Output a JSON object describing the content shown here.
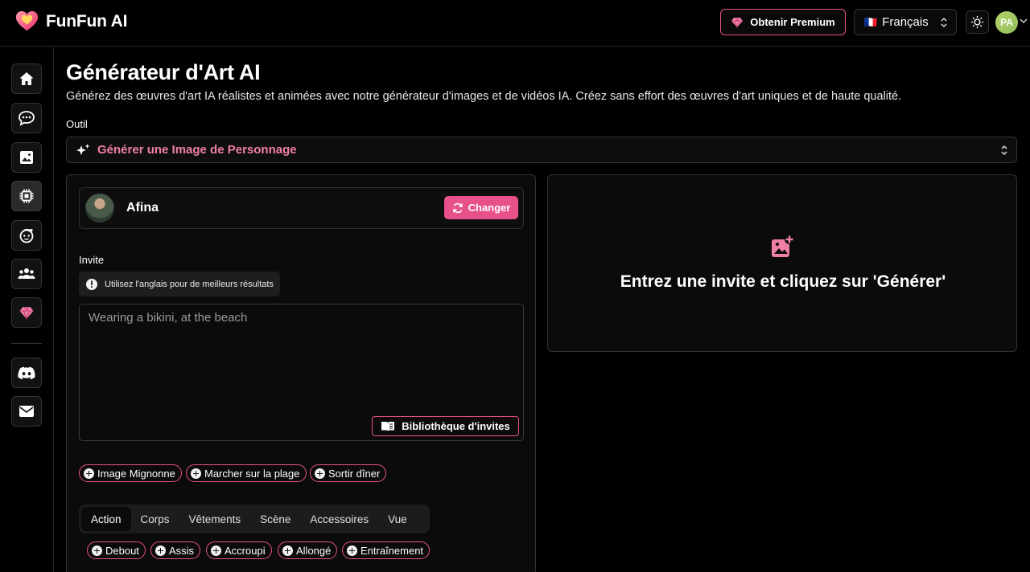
{
  "app": {
    "name": "FunFun AI",
    "premium_label": "Obtenir Premium",
    "language": "Français",
    "language_flag": "🇫🇷",
    "user_initials": "PA"
  },
  "sidebar": {
    "items": [
      {
        "icon": "home-icon"
      },
      {
        "icon": "chat-icon"
      },
      {
        "icon": "image-icon"
      },
      {
        "icon": "chip-icon"
      },
      {
        "icon": "face-icon"
      },
      {
        "icon": "group-icon"
      },
      {
        "icon": "diamond-icon"
      },
      {
        "icon": "discord-icon"
      },
      {
        "icon": "mail-icon"
      }
    ]
  },
  "page": {
    "title": "Générateur d'Art AI",
    "subtitle": "Générez des œuvres d'art IA réalistes et animées avec notre générateur d'images et de vidéos IA. Créez sans effort des œuvres d'art uniques et de haute qualité.",
    "tool_label": "Outil",
    "tool_value": "Générer une Image de Personnage"
  },
  "character": {
    "name": "Afina",
    "change_label": "Changer"
  },
  "prompt": {
    "label": "Invite",
    "hint": "Utilisez l'anglais pour de meilleurs résultats",
    "placeholder": "Wearing a bikini, at the beach",
    "library_label": "Bibliothèque d'invites"
  },
  "suggestions": [
    "Image Mignonne",
    "Marcher sur la plage",
    "Sortir dîner"
  ],
  "tabs": [
    "Action",
    "Corps",
    "Vêtements",
    "Scène",
    "Accessoires",
    "Vue"
  ],
  "actions": [
    "Debout",
    "Assis",
    "Accroupi",
    "Allongé",
    "Entraînement"
  ],
  "result": {
    "empty_text": "Entrez une invite et cliquez sur 'Générer'"
  },
  "colors": {
    "accent": "#e8508a",
    "accent_text": "#f07fa8",
    "background": "#000000"
  }
}
